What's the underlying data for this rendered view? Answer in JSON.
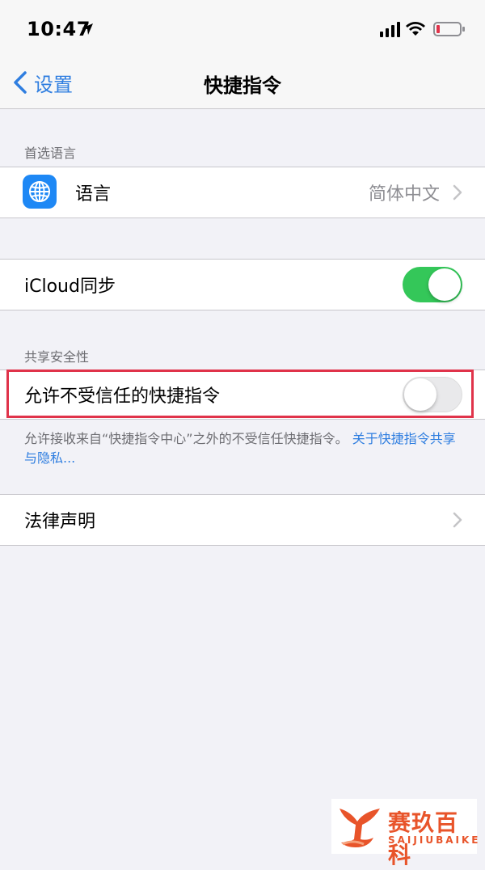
{
  "status_bar": {
    "time": "10:47"
  },
  "nav": {
    "back_label": "设置",
    "title": "快捷指令"
  },
  "sections": {
    "preferred_language_header": "首选语言",
    "shared_security_header": "共享安全性"
  },
  "language_cell": {
    "label": "语言",
    "value": "简体中文"
  },
  "icloud_cell": {
    "label": "iCloud同步",
    "toggle_on": true
  },
  "untrusted_cell": {
    "label": "允许不受信任的快捷指令",
    "toggle_on": false
  },
  "footer": {
    "text": "允许接收来自“快捷指令中心”之外的不受信任快捷指令。",
    "link_text": "关于快捷指令共享与隐私..."
  },
  "legal_cell": {
    "label": "法律声明"
  },
  "colors": {
    "accent": "#2f7ee0",
    "toggle_on": "#34c759",
    "highlight": "#e0334a",
    "watermark": "#e8542a"
  },
  "watermark": {
    "title": "赛玖百科",
    "subtitle": "SAIJIUBAIKE"
  }
}
